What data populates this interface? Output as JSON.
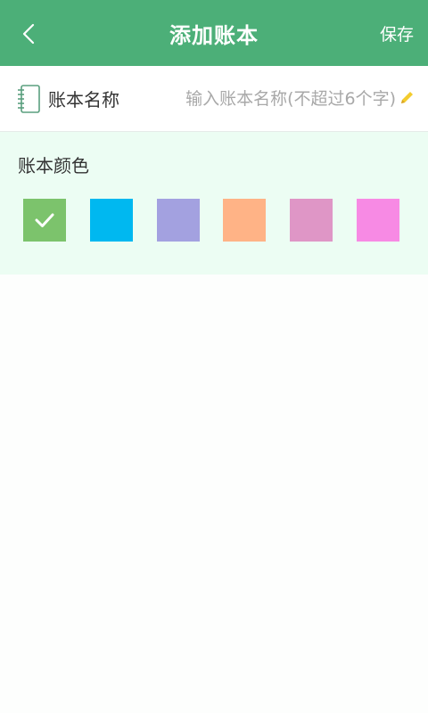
{
  "header": {
    "title": "添加账本",
    "save_label": "保存",
    "back_icon": "chevron-left-icon",
    "background": "#4caf78"
  },
  "name_field": {
    "label": "账本名称",
    "placeholder": "输入账本名称(不超过6个字)",
    "value": "",
    "icon": "notebook-icon",
    "edit_icon": "pencil-icon"
  },
  "colors": {
    "title": "账本颜色",
    "selected_index": 0,
    "swatches": [
      {
        "color": "#7cc36c",
        "selected": true
      },
      {
        "color": "#00b8f0",
        "selected": false
      },
      {
        "color": "#a3a1e0",
        "selected": false
      },
      {
        "color": "#ffb386",
        "selected": false
      },
      {
        "color": "#df96c6",
        "selected": false
      },
      {
        "color": "#f78ae4",
        "selected": false
      }
    ]
  }
}
